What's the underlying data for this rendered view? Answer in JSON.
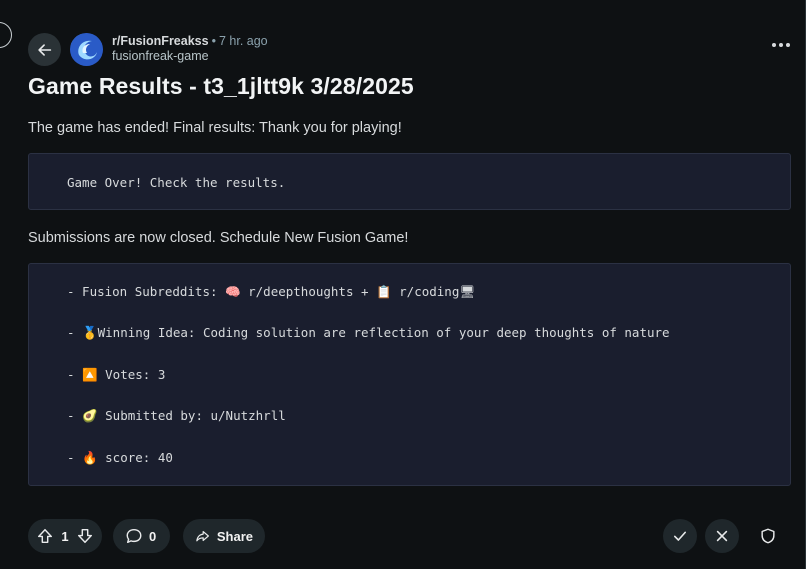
{
  "post": {
    "subreddit": "r/FusionFreakss",
    "separator": "•",
    "time_ago": "7 hr. ago",
    "author": "fusionfreak-game",
    "title": "Game Results - t3_1jltt9k 3/28/2025",
    "paragraph1": "The game has ended! Final results: Thank you for playing!",
    "code1": "Game Over! Check the results.",
    "paragraph2": "Submissions are now closed. Schedule New Fusion Game!",
    "results": [
      "- Fusion Subreddits: 🧠 r/deepthoughts + 📋 r/coding🖥",
      "- 🥇Winning Idea: Coding solution are reflection of your deep thoughts of nature",
      "- 🔼 Votes: 3",
      "- 🥑 Submitted by: u/Nutzhrll",
      "- 🔥 score: 40"
    ]
  },
  "actions": {
    "vote_count": "1",
    "comment_count": "0",
    "share_label": "Share"
  },
  "icons": {
    "back": "arrow-left-icon",
    "more": "ellipsis-icon",
    "upvote": "arrow-up-icon",
    "downvote": "arrow-down-icon",
    "comment": "speech-bubble-icon",
    "share": "share-arrow-icon",
    "approve": "checkmark-icon",
    "remove": "x-icon",
    "mod": "shield-icon"
  },
  "colors": {
    "background": "#0e1113",
    "pill": "#1f272b",
    "code_bg": "#1a1e2e"
  }
}
